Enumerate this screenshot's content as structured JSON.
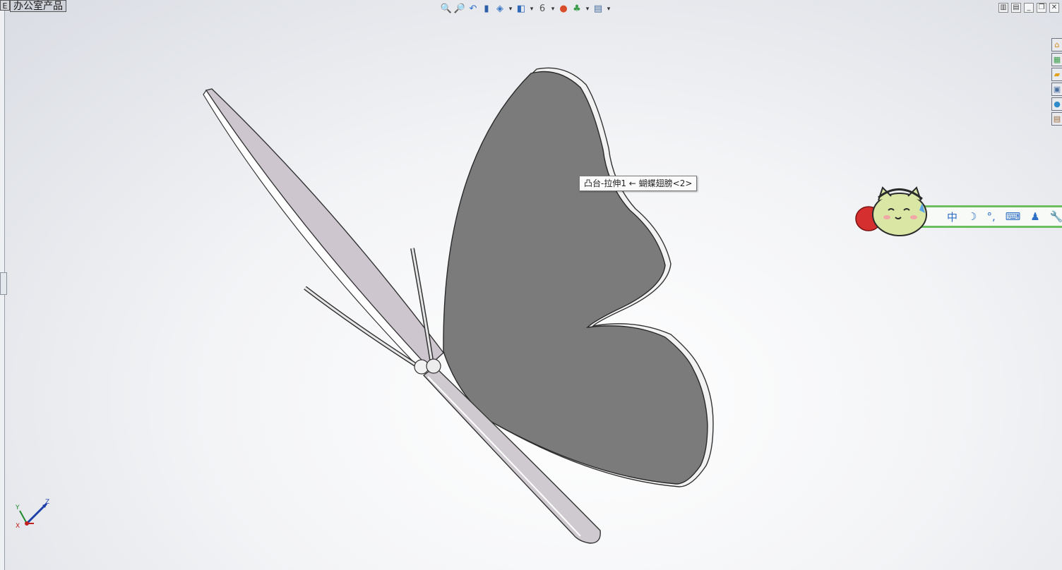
{
  "document_tab": {
    "stub": "E",
    "name": "办公室产品"
  },
  "heads_up_toolbar": [
    {
      "icon": "zoom-to-fit-icon",
      "glyph": "🔍"
    },
    {
      "icon": "zoom-to-area-icon",
      "glyph": "🔎"
    },
    {
      "icon": "previous-view-icon",
      "glyph": "↶"
    },
    {
      "icon": "section-view-icon",
      "glyph": "▮"
    },
    {
      "icon": "view-orientation-icon",
      "glyph": "◈"
    },
    {
      "icon": "display-style-icon",
      "glyph": "◧"
    },
    {
      "icon": "hide-show-items-icon",
      "glyph": "6"
    },
    {
      "icon": "edit-appearance-icon",
      "glyph": "●"
    },
    {
      "icon": "apply-scene-icon",
      "glyph": "♣"
    },
    {
      "icon": "view-settings-icon",
      "glyph": "▤"
    }
  ],
  "window_controls": [
    "tile-horizontal-icon",
    "tile-vertical-icon",
    "minimize-icon",
    "restore-icon",
    "close-icon"
  ],
  "task_pane_tabs": [
    "home-icon",
    "design-library-icon",
    "file-explorer-icon",
    "view-palette-icon",
    "appearances-icon",
    "custom-properties-icon"
  ],
  "tooltip": {
    "text": "凸台-拉伸1 ← 蝴蝶翅膀<2>"
  },
  "ime_bar": {
    "items": [
      "中",
      "☽",
      "°,",
      "⌨",
      "♟",
      "🔧"
    ]
  },
  "triad": {
    "x": "X",
    "y": "Y",
    "z": "Z"
  },
  "colors": {
    "wing": "#7b7b7b",
    "body": "#cfcacf",
    "background": "#f3f4f6"
  }
}
